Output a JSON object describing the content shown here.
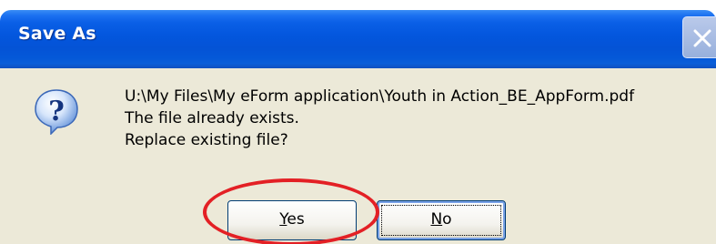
{
  "dialog": {
    "title": "Save As",
    "icon": "question-icon",
    "message_lines": [
      "U:\\My Files\\My eForm application\\Youth in Action_BE_AppForm.pdf",
      "The file already exists.",
      "Replace existing file?"
    ],
    "buttons": {
      "yes": {
        "mnemonic": "Y",
        "rest": "es"
      },
      "no": {
        "mnemonic": "N",
        "rest": "o"
      }
    },
    "annotation": {
      "color": "#e32025",
      "target": "yes"
    }
  },
  "colors": {
    "titlebar": "#0356dd",
    "client": "#ece9d8",
    "highlight": "#e32025"
  }
}
